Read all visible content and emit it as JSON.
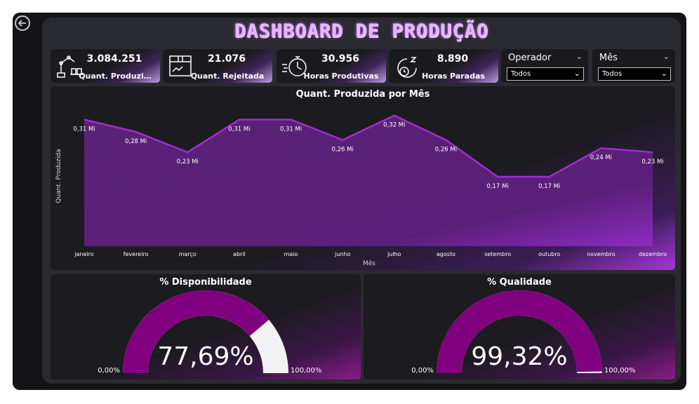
{
  "title": "DASHBOARD DE PRODUÇÃO",
  "kpis": [
    {
      "value": "3.084.251",
      "label": "Quant. Produzi…",
      "icon": "robot-arm-icon"
    },
    {
      "value": "21.076",
      "label": "Quant. Rejeitada",
      "icon": "box-icon"
    },
    {
      "value": "30.956",
      "label": "Horas Produtivas",
      "icon": "stopwatch-icon"
    },
    {
      "value": "8.890",
      "label": "Horas Paradas",
      "icon": "clock-sleep-icon"
    }
  ],
  "slicers": [
    {
      "title": "Operador",
      "value": "Todos"
    },
    {
      "title": "Mês",
      "value": "Todos"
    }
  ],
  "colors": {
    "accent": "#a02ed2",
    "area": "#5a2277",
    "gauge_fill": "#800080",
    "gauge_empty": "#f2f2f2"
  },
  "chart_data": [
    {
      "type": "area",
      "title": "Quant. Produzida por Mês",
      "xlabel": "Mês",
      "ylabel": "Quant. Produzida",
      "categories": [
        "janeiro",
        "fevereiro",
        "março",
        "abril",
        "maio",
        "junho",
        "julho",
        "agosto",
        "setembro",
        "outubro",
        "novembro",
        "dezembro"
      ],
      "values": [
        310000,
        280000,
        230000,
        310000,
        310000,
        260000,
        320000,
        260000,
        170000,
        170000,
        240000,
        230000
      ],
      "data_labels": [
        "0,31 Mi",
        "0,28 Mi",
        "0,23 Mi",
        "0,31 Mi",
        "0,31 Mi",
        "0,26 Mi",
        "0,32 Mi",
        "0,26 Mi",
        "0,17 Mi",
        "0,17 Mi",
        "0,24 Mi",
        "0,23 Mi"
      ],
      "ylim": [
        0,
        340000
      ],
      "grid": false
    },
    {
      "type": "gauge",
      "title": "% Disponibilidade",
      "value": 77.69,
      "value_label": "77,69%",
      "min_label": "0,00%",
      "max_label": "100,00%",
      "range": [
        0,
        100
      ]
    },
    {
      "type": "gauge",
      "title": "% Qualidade",
      "value": 99.32,
      "value_label": "99,32%",
      "min_label": "0,00%",
      "max_label": "100,00%",
      "range": [
        0,
        100
      ]
    }
  ]
}
